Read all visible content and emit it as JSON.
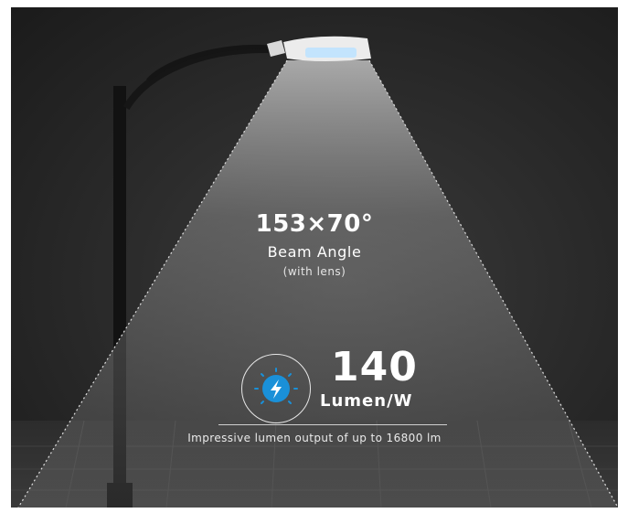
{
  "beam": {
    "angle": "153×70°",
    "label": "Beam Angle",
    "note": "(with lens)"
  },
  "efficiency": {
    "value": "140",
    "unit": "Lumen/W",
    "icon": "lightning-bolt-icon"
  },
  "footer": {
    "text": "Impressive lumen output of up to 16800 lm"
  },
  "colors": {
    "background": "#202020",
    "icon_circle": "#1a90d8",
    "beam_light": "#d9d9d9"
  }
}
